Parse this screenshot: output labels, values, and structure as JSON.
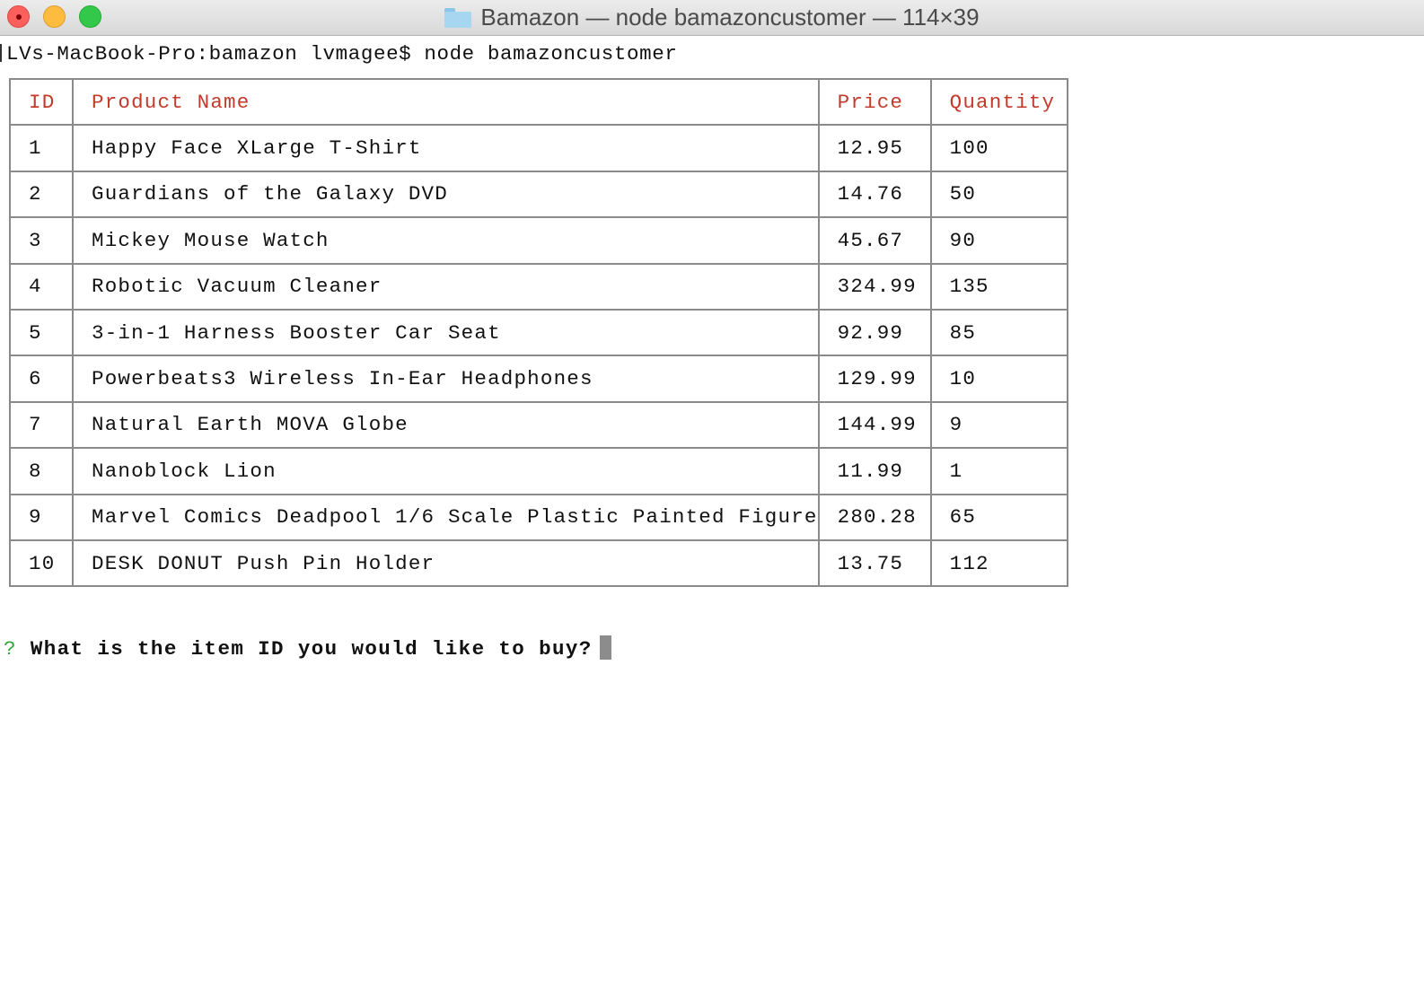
{
  "window": {
    "title": "Bamazon — node bamazoncustomer — 114×39"
  },
  "terminal": {
    "command_line": "LVs-MacBook-Pro:bamazon lvmagee$ node bamazoncustomer",
    "table": {
      "headers": [
        "ID",
        "Product Name",
        "Price",
        "Quantity"
      ],
      "rows": [
        [
          "1",
          "Happy Face XLarge T-Shirt",
          "12.95",
          "100"
        ],
        [
          "2",
          "Guardians of the Galaxy DVD",
          "14.76",
          "50"
        ],
        [
          "3",
          "Mickey Mouse Watch",
          "45.67",
          "90"
        ],
        [
          "4",
          "Robotic Vacuum Cleaner",
          "324.99",
          "135"
        ],
        [
          "5",
          "3-in-1 Harness Booster Car Seat",
          "92.99",
          "85"
        ],
        [
          "6",
          "Powerbeats3 Wireless In-Ear Headphones",
          "129.99",
          "10"
        ],
        [
          "7",
          "Natural Earth MOVA Globe",
          "144.99",
          "9"
        ],
        [
          "8",
          "Nanoblock Lion",
          "11.99",
          "1"
        ],
        [
          "9",
          "Marvel Comics Deadpool 1/6 Scale Plastic Painted Figure",
          "280.28",
          "65"
        ],
        [
          "10",
          "DESK DONUT Push Pin Holder",
          "13.75",
          "112"
        ]
      ]
    },
    "question": {
      "mark": "?",
      "text": "What is the item ID you would like to buy?"
    }
  },
  "colors": {
    "header_text": "#c23a2b",
    "question_mark": "#2ea63a",
    "table_border": "#8a8a8a"
  }
}
